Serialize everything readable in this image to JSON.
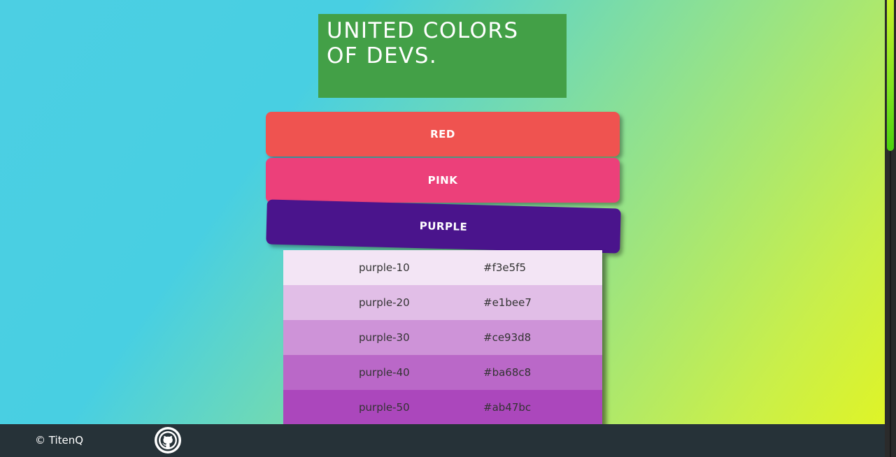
{
  "header": {
    "title": "UNITED COLORS OF DEVS.",
    "title_bg": "#43a047"
  },
  "color_buttons": [
    {
      "label": "RED",
      "color": "#ef5350"
    },
    {
      "label": "PINK",
      "color": "#ec407a"
    },
    {
      "label": "PURPLE",
      "color": "#4a148c"
    }
  ],
  "swatches": [
    {
      "name": "purple-10",
      "hex": "#f3e5f5"
    },
    {
      "name": "purple-20",
      "hex": "#e1bee7"
    },
    {
      "name": "purple-30",
      "hex": "#ce93d8"
    },
    {
      "name": "purple-40",
      "hex": "#ba68c8"
    },
    {
      "name": "purple-50",
      "hex": "#ab47bc"
    }
  ],
  "footer": {
    "copyright": "© TitenQ",
    "github_icon": "github-icon"
  }
}
